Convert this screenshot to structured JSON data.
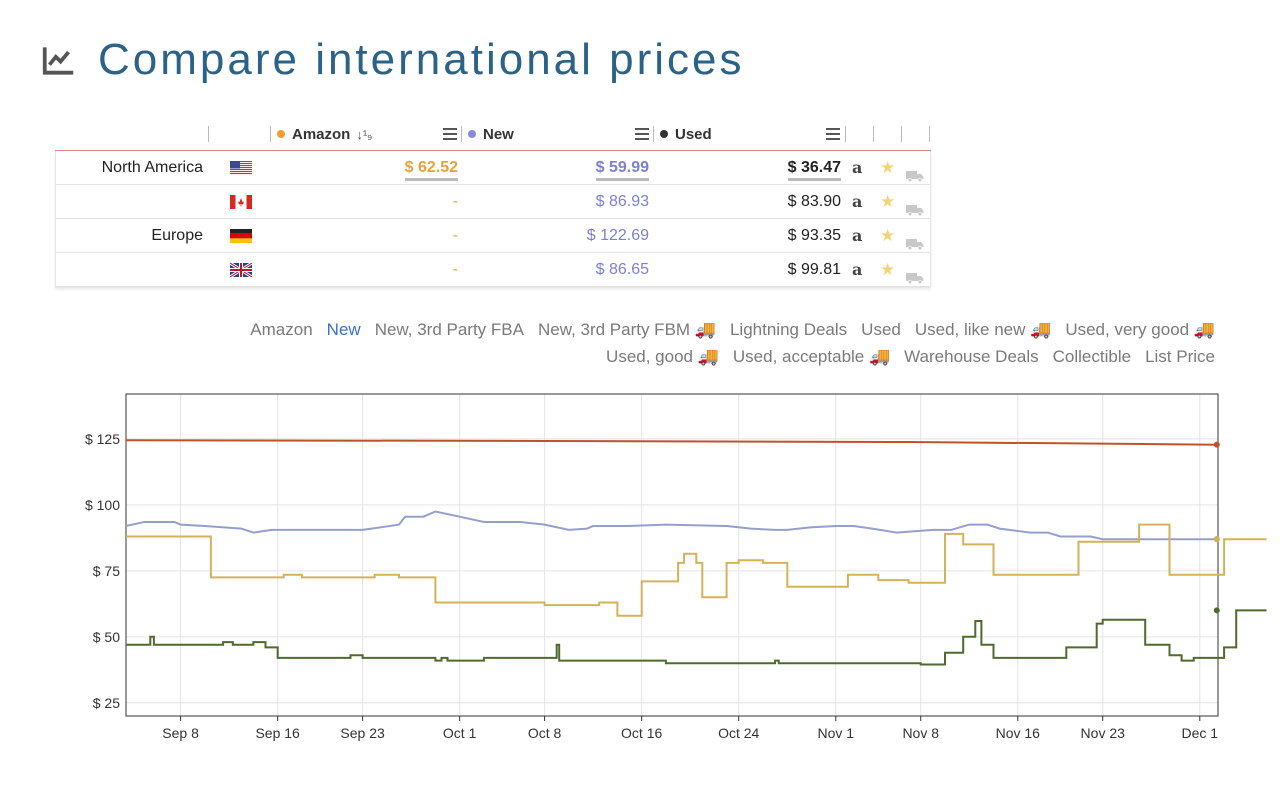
{
  "header": {
    "title": "Compare international prices",
    "icon": "chart-line-icon"
  },
  "table": {
    "columns": [
      {
        "label": "Amazon",
        "color": "#f0a030",
        "sort": "↓¹₉"
      },
      {
        "label": "New",
        "color": "#8a8ad8"
      },
      {
        "label": "Used",
        "color": "#333333"
      }
    ],
    "rows": [
      {
        "region": "North America",
        "flag": "us",
        "amazon": "$ 62.52",
        "new": "$ 59.99",
        "used": "$ 36.47",
        "highlight": true
      },
      {
        "region": "",
        "flag": "ca",
        "amazon": "-",
        "new": "$ 86.93",
        "used": "$ 83.90",
        "highlight": false
      },
      {
        "region": "Europe",
        "flag": "de",
        "amazon": "-",
        "new": "$ 122.69",
        "used": "$ 93.35",
        "highlight": false
      },
      {
        "region": "",
        "flag": "gb",
        "amazon": "-",
        "new": "$ 86.65",
        "used": "$ 99.81",
        "highlight": false
      }
    ],
    "icons": {
      "amazon": "a",
      "star": "★",
      "truck": "truck-icon"
    }
  },
  "legend": {
    "line1": [
      "Amazon",
      "New",
      "New, 3rd Party FBA",
      "New, 3rd Party FBM 🚚",
      "Lightning Deals",
      "Used",
      "Used, like new 🚚",
      "Used, very good 🚚"
    ],
    "line2": [
      "Used, good 🚚",
      "Used, acceptable 🚚",
      "Warehouse Deals",
      "Collectible",
      "List Price"
    ],
    "active": "New"
  },
  "chart_data": {
    "type": "line",
    "title": "",
    "xlabel": "",
    "ylabel": "",
    "x_ticks": [
      "Sep 8",
      "Sep 16",
      "Sep 23",
      "Oct 1",
      "Oct 8",
      "Oct 16",
      "Oct 24",
      "Nov 1",
      "Nov 8",
      "Nov 16",
      "Nov 23",
      "Dec 1"
    ],
    "y_ticks": [
      "$ 25",
      "$ 50",
      "$ 75",
      "$ 100",
      "$ 125"
    ],
    "ylim": [
      20,
      142
    ],
    "x_range_days": [
      -4.5,
      85.5
    ],
    "x_unit": "days after Sep 8",
    "grid": true,
    "series": [
      {
        "color": "#c0522a",
        "step": false,
        "points": [
          [
            -4.5,
            124.5
          ],
          [
            30,
            124.2
          ],
          [
            60,
            123.8
          ],
          [
            85.5,
            122.8
          ]
        ]
      },
      {
        "color": "#959fcc",
        "step": true,
        "points": [
          [
            -4.5,
            92
          ],
          [
            -3,
            93.5
          ],
          [
            -0.5,
            93.5
          ],
          [
            0,
            92.5
          ],
          [
            2,
            92
          ],
          [
            5,
            91
          ],
          [
            6,
            89.5
          ],
          [
            7.5,
            90.5
          ],
          [
            11,
            90.5
          ],
          [
            15,
            90.5
          ],
          [
            18,
            92.5
          ],
          [
            18.5,
            95.5
          ],
          [
            20,
            95.5
          ],
          [
            21,
            97.5
          ],
          [
            23,
            95.5
          ],
          [
            25,
            93.5
          ],
          [
            28,
            93.5
          ],
          [
            30,
            92.5
          ],
          [
            32,
            90.5
          ],
          [
            33.5,
            91
          ],
          [
            34,
            92
          ],
          [
            37,
            92
          ],
          [
            40,
            92.5
          ],
          [
            45,
            92
          ],
          [
            47,
            91
          ],
          [
            49,
            90.5
          ],
          [
            50,
            90.5
          ],
          [
            52,
            91.5
          ],
          [
            54,
            92
          ],
          [
            55.5,
            92
          ],
          [
            57,
            91
          ],
          [
            59,
            89.5
          ],
          [
            62,
            90.5
          ],
          [
            63.5,
            90.5
          ],
          [
            65,
            92.5
          ],
          [
            66.5,
            92.5
          ],
          [
            67.5,
            91
          ],
          [
            70,
            89.5
          ],
          [
            71.5,
            89.5
          ],
          [
            72.5,
            88
          ],
          [
            75,
            88
          ],
          [
            76,
            87
          ],
          [
            85.5,
            87
          ]
        ]
      },
      {
        "color": "#d4b25a",
        "step": true,
        "points": [
          [
            -4.5,
            88
          ],
          [
            2.5,
            88
          ],
          [
            2.5,
            72.5
          ],
          [
            8.5,
            72.5
          ],
          [
            8.5,
            73.5
          ],
          [
            10,
            73.5
          ],
          [
            10,
            72.5
          ],
          [
            16,
            72.5
          ],
          [
            16,
            73.5
          ],
          [
            18,
            73.5
          ],
          [
            18,
            72.5
          ],
          [
            21,
            72.5
          ],
          [
            21,
            63
          ],
          [
            30,
            63
          ],
          [
            30,
            62
          ],
          [
            34.5,
            62
          ],
          [
            34.5,
            63
          ],
          [
            36,
            63
          ],
          [
            36,
            58
          ],
          [
            38,
            58
          ],
          [
            38,
            71
          ],
          [
            41,
            71
          ],
          [
            41,
            78
          ],
          [
            41.5,
            78
          ],
          [
            41.5,
            81.5
          ],
          [
            42.5,
            81.5
          ],
          [
            42.5,
            78
          ],
          [
            43,
            78
          ],
          [
            43,
            65
          ],
          [
            45,
            65
          ],
          [
            45,
            78
          ],
          [
            46,
            78
          ],
          [
            46,
            79
          ],
          [
            48,
            79
          ],
          [
            48,
            78
          ],
          [
            50,
            78
          ],
          [
            50,
            69
          ],
          [
            55,
            69
          ],
          [
            55,
            73.5
          ],
          [
            57.5,
            73.5
          ],
          [
            57.5,
            71.5
          ],
          [
            60,
            71.5
          ],
          [
            60,
            70.5
          ],
          [
            63,
            70.5
          ],
          [
            63,
            89
          ],
          [
            64.5,
            89
          ],
          [
            64.5,
            85
          ],
          [
            67,
            85
          ],
          [
            67,
            73.5
          ],
          [
            74,
            73.5
          ],
          [
            74,
            86
          ],
          [
            79,
            86
          ],
          [
            79,
            92.5
          ],
          [
            81.5,
            92.5
          ],
          [
            81.5,
            73.5
          ],
          [
            86,
            73.5
          ],
          [
            86,
            87
          ],
          [
            89.5,
            87
          ]
        ]
      },
      {
        "color": "#4f6a2c",
        "step": true,
        "points": [
          [
            -4.5,
            47
          ],
          [
            -2.5,
            47
          ],
          [
            -2.5,
            50
          ],
          [
            -2.2,
            50
          ],
          [
            -2.2,
            47
          ],
          [
            0,
            47
          ],
          [
            3.5,
            47
          ],
          [
            3.5,
            48
          ],
          [
            4.3,
            48
          ],
          [
            4.3,
            47
          ],
          [
            6,
            47
          ],
          [
            6,
            48
          ],
          [
            7,
            48
          ],
          [
            7,
            46
          ],
          [
            8,
            46
          ],
          [
            8,
            42
          ],
          [
            14,
            42
          ],
          [
            14,
            43
          ],
          [
            15,
            43
          ],
          [
            15,
            42
          ],
          [
            21,
            42
          ],
          [
            21,
            41
          ],
          [
            21.5,
            41
          ],
          [
            21.5,
            42
          ],
          [
            22,
            42
          ],
          [
            22,
            41
          ],
          [
            25,
            41
          ],
          [
            25,
            42
          ],
          [
            31,
            42
          ],
          [
            31,
            47
          ],
          [
            31.2,
            47
          ],
          [
            31.2,
            41
          ],
          [
            40,
            41
          ],
          [
            40,
            40
          ],
          [
            49,
            40
          ],
          [
            49,
            41
          ],
          [
            49.3,
            41
          ],
          [
            49.3,
            40
          ],
          [
            61,
            40
          ],
          [
            61,
            39.5
          ],
          [
            63,
            39.5
          ],
          [
            63,
            44
          ],
          [
            64.5,
            44
          ],
          [
            64.5,
            50
          ],
          [
            65.5,
            50
          ],
          [
            65.5,
            56
          ],
          [
            66,
            56
          ],
          [
            66,
            47
          ],
          [
            67,
            47
          ],
          [
            67,
            42
          ],
          [
            73,
            42
          ],
          [
            73,
            46
          ],
          [
            75.5,
            46
          ],
          [
            75.5,
            55
          ],
          [
            76,
            55
          ],
          [
            76,
            56.5
          ],
          [
            79.5,
            56.5
          ],
          [
            79.5,
            47
          ],
          [
            81.5,
            47
          ],
          [
            81.5,
            43
          ],
          [
            82.5,
            43
          ],
          [
            82.5,
            41
          ],
          [
            83.5,
            41
          ],
          [
            83.5,
            42
          ],
          [
            86,
            42
          ],
          [
            86,
            46
          ],
          [
            87,
            46
          ],
          [
            87,
            60
          ],
          [
            89.5,
            60
          ]
        ]
      }
    ]
  }
}
